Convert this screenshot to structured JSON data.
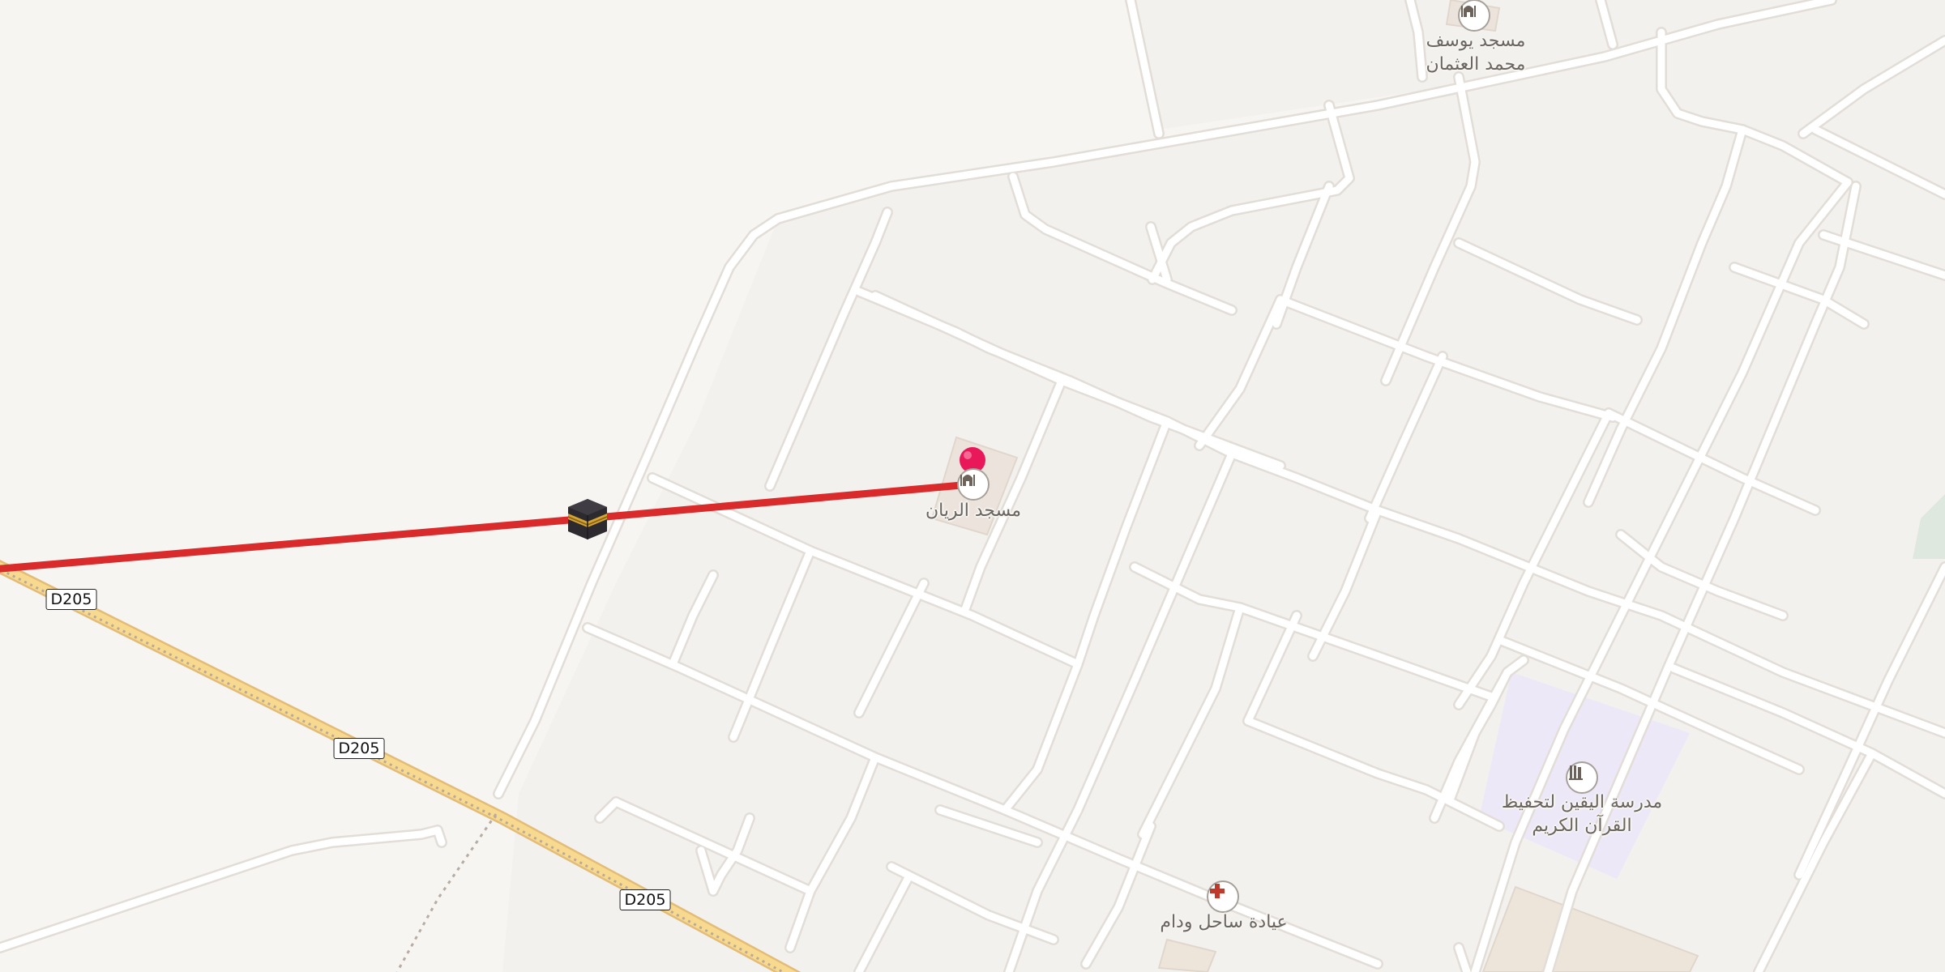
{
  "map": {
    "roads": [
      {
        "name": "route-d205",
        "ref": "D205",
        "labels": [
          "D205",
          "D205",
          "D205"
        ]
      }
    ],
    "pois": [
      {
        "id": "mosque-al-rayan",
        "name": "مسجد الريان",
        "icon": "mosque-icon",
        "type": "place_of_worship"
      },
      {
        "id": "mosque-yousef",
        "name_line1": "مسجد يوسف",
        "name_line2": "محمد العثمان",
        "icon": "mosque-icon",
        "type": "place_of_worship"
      },
      {
        "id": "school-al-yaqeen",
        "name_line1": "مدرسة اليقين لتحفيظ",
        "name_line2": "القرآن الكريم",
        "icon": "school-icon",
        "type": "school"
      },
      {
        "id": "clinic-sahel",
        "name": "عيادة ساحل ودام",
        "icon": "clinic-cross-icon",
        "type": "clinic"
      }
    ],
    "markers": {
      "selected_pin": {
        "icon": "map-pin-icon",
        "color": "#e8185a"
      },
      "qibla_marker": {
        "icon": "kaaba-icon"
      },
      "qibla_line_color": "#d92b2b"
    },
    "colors": {
      "background": "#f7f5f2",
      "block": "#f3f1ee",
      "street": "#ffffff",
      "street_casing": "#e2ddd7",
      "primary_road_fill": "#f7d990",
      "primary_road_casing": "#e3bc77",
      "school_area": "#ede8f8",
      "park": "#dfe8de"
    }
  }
}
